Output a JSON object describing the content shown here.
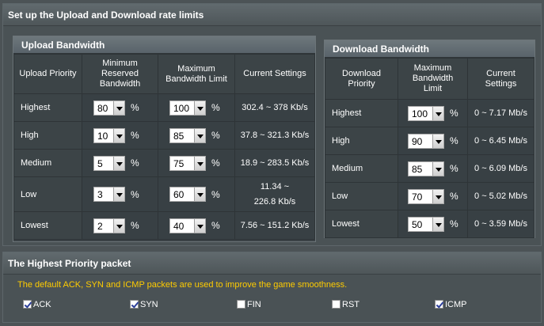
{
  "title": "Set up the Upload and Download rate limits",
  "upload": {
    "title": "Upload Bandwidth",
    "headers": {
      "priority": "Upload Priority",
      "min": "Minimum Reserved Bandwidth",
      "max": "Maximum Bandwidth Limit",
      "current": "Current Settings"
    },
    "rows": [
      {
        "priority": "Highest",
        "min": "80",
        "max": "100",
        "current": "302.4 ~ 378 Kb/s"
      },
      {
        "priority": "High",
        "min": "10",
        "max": "85",
        "current": "37.8 ~ 321.3 Kb/s"
      },
      {
        "priority": "Medium",
        "min": "5",
        "max": "75",
        "current": "18.9 ~ 283.5 Kb/s"
      },
      {
        "priority": "Low",
        "min": "3",
        "max": "60",
        "current": "11.34 ~ 226.8 Kb/s"
      },
      {
        "priority": "Lowest",
        "min": "2",
        "max": "40",
        "current": "7.56 ~ 151.2 Kb/s"
      }
    ]
  },
  "download": {
    "title": "Download Bandwidth",
    "headers": {
      "priority": "Download Priority",
      "max": "Maximum Bandwidth Limit",
      "current": "Current Settings"
    },
    "rows": [
      {
        "priority": "Highest",
        "max": "100",
        "current": "0 ~ 7.17 Mb/s"
      },
      {
        "priority": "High",
        "max": "90",
        "current": "0 ~ 6.45 Mb/s"
      },
      {
        "priority": "Medium",
        "max": "85",
        "current": "0 ~ 6.09 Mb/s"
      },
      {
        "priority": "Low",
        "max": "70",
        "current": "0 ~ 5.02 Mb/s"
      },
      {
        "priority": "Lowest",
        "max": "50",
        "current": "0 ~ 3.59 Mb/s"
      }
    ]
  },
  "percent": "%",
  "packet": {
    "title": "The Highest Priority packet",
    "notice": "The default ACK, SYN and ICMP packets are used to improve the game smoothness.",
    "options": [
      {
        "label": "ACK",
        "checked": true
      },
      {
        "label": "SYN",
        "checked": true
      },
      {
        "label": "FIN",
        "checked": false
      },
      {
        "label": "RST",
        "checked": false
      },
      {
        "label": "ICMP",
        "checked": true
      }
    ]
  },
  "colors": {
    "notice": "#ffcc00",
    "background": "#4c5356"
  }
}
